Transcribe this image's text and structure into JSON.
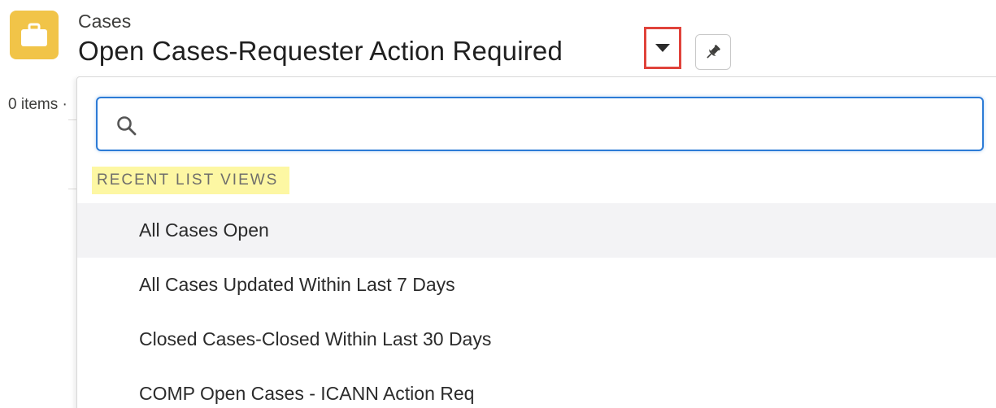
{
  "header": {
    "object_label": "Cases",
    "list_title": "Open Cases-Requester Action Required",
    "icon": "briefcase-icon",
    "accent_color": "#f1c448",
    "highlight_color": "#e0433b"
  },
  "background": {
    "items_count": "0 items ·"
  },
  "dropdown": {
    "search": {
      "value": "",
      "placeholder": "",
      "icon": "search-icon"
    },
    "section_header": "RECENT LIST VIEWS",
    "section_highlight_color": "#fdf7a3",
    "items": [
      {
        "label": "All Cases Open",
        "hovered": true
      },
      {
        "label": "All Cases Updated Within Last 7 Days"
      },
      {
        "label": "Closed Cases-Closed Within Last 30 Days"
      },
      {
        "label": "COMP Open Cases - ICANN Action Req"
      }
    ]
  }
}
